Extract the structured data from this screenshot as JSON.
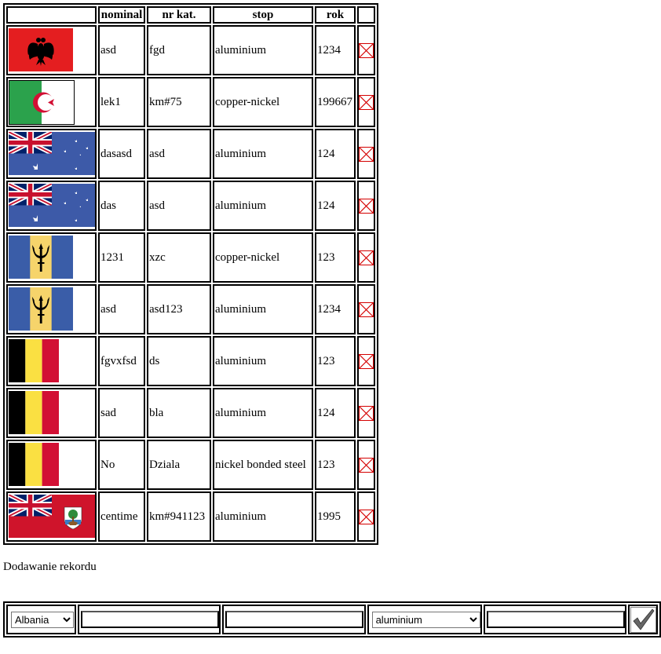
{
  "table": {
    "headers": [
      "",
      "nominal",
      "nr kat.",
      "stop",
      "rok",
      ""
    ],
    "rows": [
      {
        "flag": "albania-flag",
        "nominal": "asd",
        "nr_kat": "fgd",
        "stop": "aluminium",
        "rok": "1234"
      },
      {
        "flag": "algeria-flag",
        "nominal": "lek1",
        "nr_kat": "km#75",
        "stop": "copper-nickel",
        "rok": "199667"
      },
      {
        "flag": "australia-flag",
        "nominal": "dasasd",
        "nr_kat": "asd",
        "stop": "aluminium",
        "rok": "124"
      },
      {
        "flag": "australia-flag",
        "nominal": "das",
        "nr_kat": "asd",
        "stop": "aluminium",
        "rok": "124"
      },
      {
        "flag": "barbados-flag",
        "nominal": "1231",
        "nr_kat": "xzc",
        "stop": "copper-nickel",
        "rok": "123"
      },
      {
        "flag": "barbados-flag",
        "nominal": "asd",
        "nr_kat": "asd123",
        "stop": "aluminium",
        "rok": "1234"
      },
      {
        "flag": "belgium-flag",
        "nominal": "fgvxfsd",
        "nr_kat": "ds",
        "stop": "aluminium",
        "rok": "123"
      },
      {
        "flag": "belgium-flag",
        "nominal": "sad",
        "nr_kat": "bla",
        "stop": "aluminium",
        "rok": "124"
      },
      {
        "flag": "belgium-flag",
        "nominal": "No",
        "nr_kat": "Dziala",
        "stop": "nickel bonded steel",
        "rok": "123"
      },
      {
        "flag": "bermuda-flag",
        "nominal": "centime",
        "nr_kat": "km#941123",
        "stop": "aluminium",
        "rok": "1995"
      }
    ]
  },
  "form": {
    "title": "Dodawanie rekordu",
    "country_selected": "Albania",
    "nominal_value": "",
    "nr_kat_value": "",
    "stop_selected": "aluminium",
    "rok_value": ""
  },
  "colors": {
    "albania_red": "#e41e20",
    "algeria_green": "#2ba24c",
    "algeria_red": "#d21034",
    "flag_blue": "#3d5aa8",
    "union_red": "#c8102e",
    "barbados_blue": "#3a5da8",
    "barbados_gold": "#f6d46b",
    "belgium_yellow": "#fae042",
    "belgium_red": "#d21034",
    "bermuda_red": "#cf142b",
    "delete_red": "#d40000"
  }
}
